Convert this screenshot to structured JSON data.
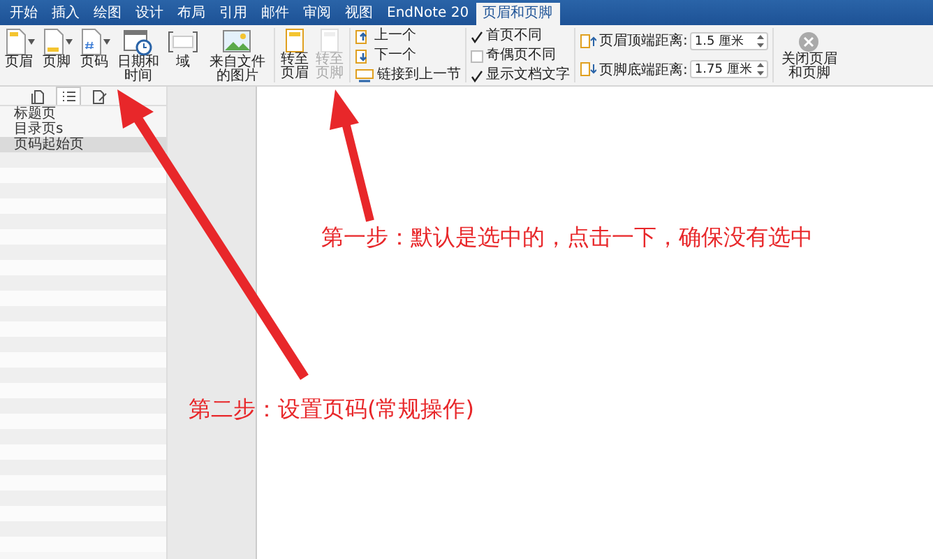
{
  "tabs": [
    {
      "label": "开始",
      "selected": false
    },
    {
      "label": "插入",
      "selected": false
    },
    {
      "label": "绘图",
      "selected": false
    },
    {
      "label": "设计",
      "selected": false
    },
    {
      "label": "布局",
      "selected": false
    },
    {
      "label": "引用",
      "selected": false
    },
    {
      "label": "邮件",
      "selected": false
    },
    {
      "label": "审阅",
      "selected": false
    },
    {
      "label": "视图",
      "selected": false
    },
    {
      "label": "EndNote 20",
      "selected": false
    },
    {
      "label": "页眉和页脚",
      "selected": true
    }
  ],
  "ribbon": {
    "insert_buttons": [
      {
        "label": "页眉",
        "kind": "header",
        "dropdown": true
      },
      {
        "label": "页脚",
        "kind": "footer",
        "dropdown": true
      },
      {
        "label": "页码",
        "kind": "pagenum",
        "dropdown": true
      },
      {
        "label": "日期和时间",
        "kind": "datetime",
        "dropdown": false
      },
      {
        "label": "域",
        "kind": "field",
        "dropdown": false
      },
      {
        "label": "来自文件的图片",
        "kind": "picture",
        "dropdown": false
      }
    ],
    "goto_buttons": [
      {
        "label": "转至页眉",
        "disabled": false
      },
      {
        "label": "转至页脚",
        "disabled": true
      }
    ],
    "nav_buttons": [
      {
        "label": "上一个",
        "kind": "up"
      },
      {
        "label": "下一个",
        "kind": "down"
      },
      {
        "label": "链接到上一节",
        "kind": "link"
      }
    ],
    "options": [
      {
        "label": "首页不同",
        "checked": true
      },
      {
        "label": "奇偶页不同",
        "checked": false
      },
      {
        "label": "显示文档文字",
        "checked": true
      }
    ],
    "positions": [
      {
        "label": "页眉顶端距离:",
        "value": "1.5 厘米",
        "kind": "top"
      },
      {
        "label": "页脚底端距离:",
        "value": "1.75 厘米",
        "kind": "bottom"
      }
    ],
    "close_button": {
      "label": "关闭页眉和页脚"
    }
  },
  "sidebar": {
    "tabs": [
      {
        "kind": "thumbnails",
        "selected": false
      },
      {
        "kind": "outline",
        "selected": true
      },
      {
        "kind": "search",
        "selected": false
      }
    ],
    "items": [
      {
        "label": "标题页",
        "selected": false
      },
      {
        "label": "目录页s",
        "selected": false
      },
      {
        "label": "页码起始页",
        "selected": true
      }
    ]
  },
  "annotations": [
    {
      "text": "第一步：默认是选中的，点击一下，确保没有选中"
    },
    {
      "text": "第二步：设置页码(常规操作)"
    }
  ]
}
